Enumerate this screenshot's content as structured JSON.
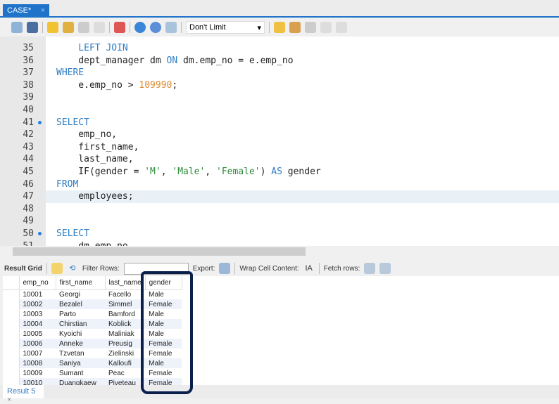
{
  "tab": {
    "title": "CASE*",
    "close": "×"
  },
  "toolbar": {
    "limit": "Don't Limit",
    "icons": [
      "open-folder-icon",
      "save-icon",
      "execute-icon",
      "execute-current-icon",
      "explain-icon",
      "stop-icon",
      "toggle-error-icon",
      "commit-icon",
      "rollback-icon",
      "autocommit-icon",
      "add-snippet-icon",
      "beautify-icon",
      "find-icon",
      "invisible-chars-icon",
      "wrap-icon"
    ]
  },
  "editor": {
    "lines": [
      {
        "n": "35",
        "code": [
          [
            "",
            "    "
          ],
          [
            "kw",
            "LEFT JOIN"
          ]
        ]
      },
      {
        "n": "36",
        "code": [
          [
            "",
            "    dept_manager dm "
          ],
          [
            "kw",
            "ON"
          ],
          [
            "",
            " dm.emp_no = e.emp_no"
          ]
        ]
      },
      {
        "n": "37",
        "code": [
          [
            "kw",
            "WHERE"
          ]
        ]
      },
      {
        "n": "38",
        "code": [
          [
            "",
            "    e.emp_no > "
          ],
          [
            "num",
            "109990"
          ],
          [
            "",
            ";"
          ]
        ]
      },
      {
        "n": "39",
        "code": []
      },
      {
        "n": "40",
        "code": []
      },
      {
        "n": "41",
        "dot": true,
        "code": [
          [
            "kw",
            "SELECT"
          ]
        ]
      },
      {
        "n": "42",
        "code": [
          [
            "",
            "    emp_no,"
          ]
        ]
      },
      {
        "n": "43",
        "code": [
          [
            "",
            "    first_name,"
          ]
        ]
      },
      {
        "n": "44",
        "code": [
          [
            "",
            "    last_name,"
          ]
        ]
      },
      {
        "n": "45",
        "code": [
          [
            "",
            "    IF(gender = "
          ],
          [
            "str",
            "'M'"
          ],
          [
            ",",
            ", "
          ],
          [
            "str",
            "'Male'"
          ],
          [
            "",
            ", "
          ],
          [
            "str",
            "'Female'"
          ],
          [
            "",
            ") "
          ],
          [
            "kw",
            "AS"
          ],
          [
            "",
            " gender"
          ]
        ]
      },
      {
        "n": "46",
        "code": [
          [
            "kw",
            "FROM"
          ]
        ]
      },
      {
        "n": "47",
        "hl": true,
        "code": [
          [
            "",
            "    employees;"
          ]
        ]
      },
      {
        "n": "48",
        "code": []
      },
      {
        "n": "49",
        "code": []
      },
      {
        "n": "50",
        "dot": true,
        "code": [
          [
            "kw",
            "SELECT"
          ]
        ]
      },
      {
        "n": "51",
        "code": [
          [
            "",
            "    dm.emp_no,"
          ]
        ]
      }
    ]
  },
  "results": {
    "result_grid": "Result Grid",
    "filter_rows": "Filter Rows:",
    "export": "Export:",
    "wrap": "Wrap Cell Content:",
    "fetch": "Fetch rows:",
    "columns": [
      "emp_no",
      "first_name",
      "last_name",
      "gender"
    ],
    "rows": [
      [
        "10001",
        "Georgi",
        "Facello",
        "Male"
      ],
      [
        "10002",
        "Bezalel",
        "Simmel",
        "Female"
      ],
      [
        "10003",
        "Parto",
        "Bamford",
        "Male"
      ],
      [
        "10004",
        "Chirstian",
        "Koblick",
        "Male"
      ],
      [
        "10005",
        "Kyoichi",
        "Maliniak",
        "Male"
      ],
      [
        "10006",
        "Anneke",
        "Preusig",
        "Female"
      ],
      [
        "10007",
        "Tzvetan",
        "Zielinski",
        "Female"
      ],
      [
        "10008",
        "Saniya",
        "Kalloufi",
        "Male"
      ],
      [
        "10009",
        "Sumant",
        "Peac",
        "Female"
      ],
      [
        "10010",
        "Duangkaew",
        "Piveteau",
        "Female"
      ]
    ],
    "result_tab": "Result 5",
    "result_tab_close": "×"
  }
}
